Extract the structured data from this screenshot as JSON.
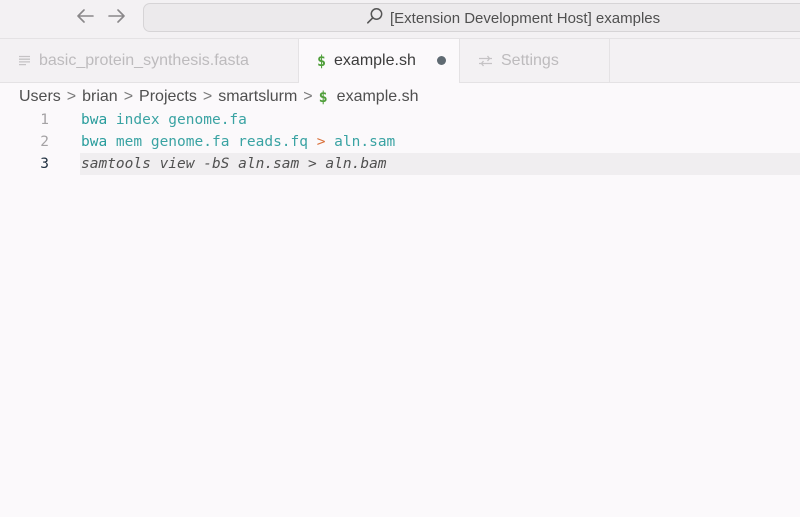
{
  "titlebar": {
    "back_icon": "arrow-left-icon",
    "forward_icon": "arrow-right-icon",
    "search_icon": "search-icon",
    "command_center_text": "[Extension Development Host] examples"
  },
  "tabs": [
    {
      "label": "basic_protein_synthesis.fasta",
      "icon": "lines-icon",
      "active": false
    },
    {
      "label": "example.sh",
      "icon": "dollar-icon",
      "active": true,
      "dirty": true
    },
    {
      "label": "Settings",
      "icon": "sliders-icon",
      "active": false
    }
  ],
  "breadcrumb": {
    "items": [
      "Users",
      "brian",
      "Projects",
      "smartslurm"
    ],
    "file_icon": "$",
    "file": "example.sh",
    "separator": ">"
  },
  "editor": {
    "current_line": 3,
    "line_numbers": [
      "1",
      "2",
      "3"
    ],
    "lines": [
      {
        "tokens": [
          {
            "text": "bwa",
            "kind": "cmd"
          },
          {
            "text": " index genome.fa",
            "kind": "arg"
          }
        ]
      },
      {
        "tokens": [
          {
            "text": "bwa",
            "kind": "cmd"
          },
          {
            "text": " mem genome.fa reads.fq ",
            "kind": "arg"
          },
          {
            "text": ">",
            "kind": "op"
          },
          {
            "text": " aln.sam",
            "kind": "arg"
          }
        ]
      },
      {
        "tokens": [
          {
            "text": "samtools view -bS aln.sam > aln.bam",
            "kind": "plain"
          }
        ]
      }
    ]
  },
  "colors": {
    "command": "#2a9d9d",
    "argument": "#3aa3a3",
    "operator": "#d9703a",
    "dollar_icon": "#4f9e3a",
    "dirty_dot": "#5f6a72"
  }
}
